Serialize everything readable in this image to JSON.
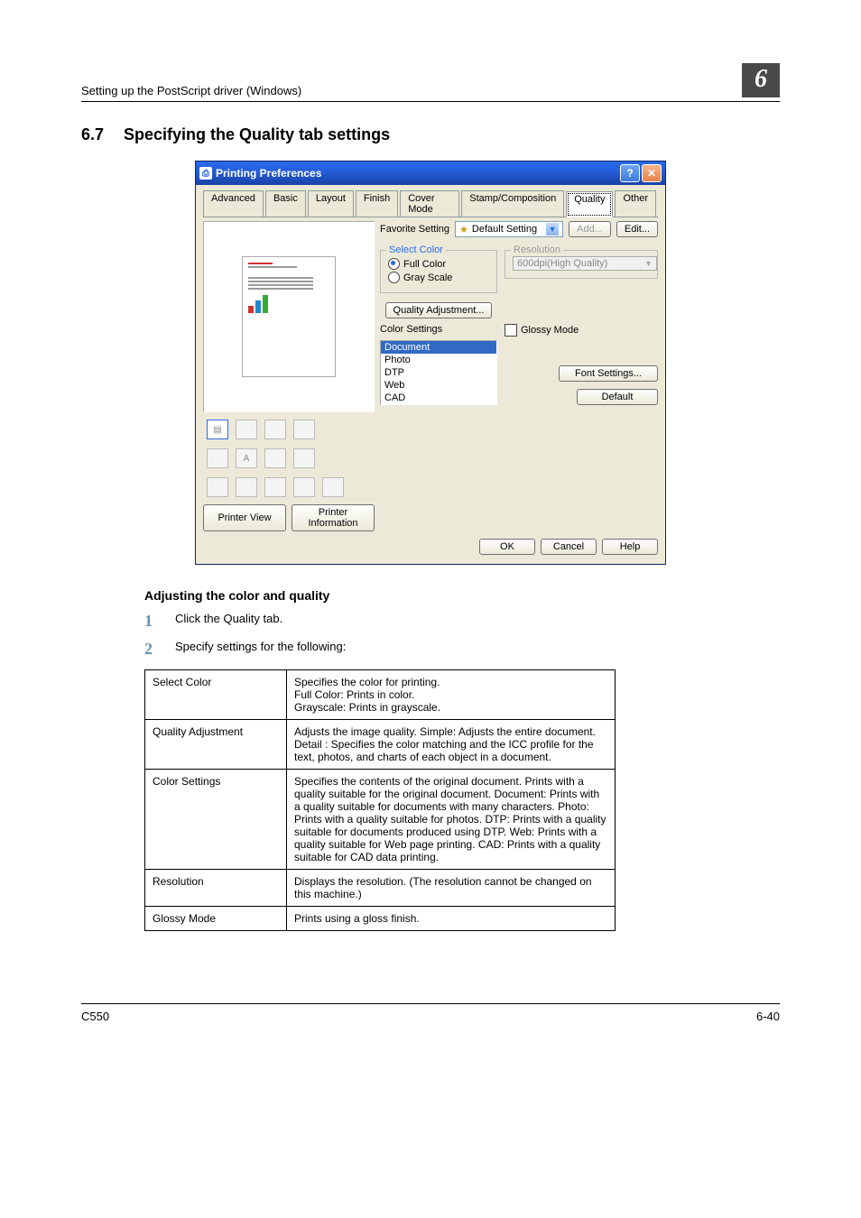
{
  "header": {
    "left": "Setting up the PostScript driver (Windows)",
    "chapter": "6"
  },
  "section": {
    "number": "6.7",
    "title": "Specifying the Quality tab settings"
  },
  "dialog": {
    "title": "Printing Preferences",
    "tabs": [
      "Advanced",
      "Basic",
      "Layout",
      "Finish",
      "Cover Mode",
      "Stamp/Composition",
      "Quality",
      "Other"
    ],
    "favorite_label": "Favorite Setting",
    "favorite_value": "Default Setting",
    "add_btn": "Add...",
    "edit_btn": "Edit...",
    "select_color_label": "Select Color",
    "full_color": "Full Color",
    "gray_scale": "Gray Scale",
    "quality_adjust_btn": "Quality Adjustment...",
    "color_settings_label": "Color Settings",
    "color_settings_items": [
      "Document",
      "Photo",
      "DTP",
      "Web",
      "CAD"
    ],
    "resolution_label": "Resolution",
    "resolution_value": "600dpi(High Quality)",
    "glossy_label": "Glossy Mode",
    "font_settings_btn": "Font Settings...",
    "default_btn": "Default",
    "printer_view_btn": "Printer View",
    "printer_info_btn": "Printer Information",
    "ok": "OK",
    "cancel": "Cancel",
    "help": "Help"
  },
  "subhead": "Adjusting the color and quality",
  "steps": [
    "Click the Quality tab.",
    "Specify settings for the following:"
  ],
  "table": [
    {
      "k": "Select Color",
      "v": "Specifies the color for printing.\nFull Color: Prints in color.\nGrayscale: Prints in grayscale."
    },
    {
      "k": "Quality Adjustment",
      "v": "Adjusts the image quality. Simple: Adjusts the entire document. Detail : Specifies the color matching and the ICC profile for the text, photos, and charts of each object in a document."
    },
    {
      "k": "Color Settings",
      "v": "Specifies the contents of the original document. Prints with a quality suitable for the original document. Document: Prints with a quality suitable for documents with many characters. Photo: Prints with a quality suitable for photos. DTP: Prints with a quality suitable for documents produced using DTP. Web: Prints with a quality suitable for Web page printing. CAD: Prints with a quality suitable for CAD data printing."
    },
    {
      "k": "Resolution",
      "v": "Displays the resolution. (The resolution cannot be changed on this machine.)"
    },
    {
      "k": "Glossy Mode",
      "v": "Prints using a gloss finish."
    }
  ],
  "footer": {
    "left": "C550",
    "right": "6-40"
  }
}
